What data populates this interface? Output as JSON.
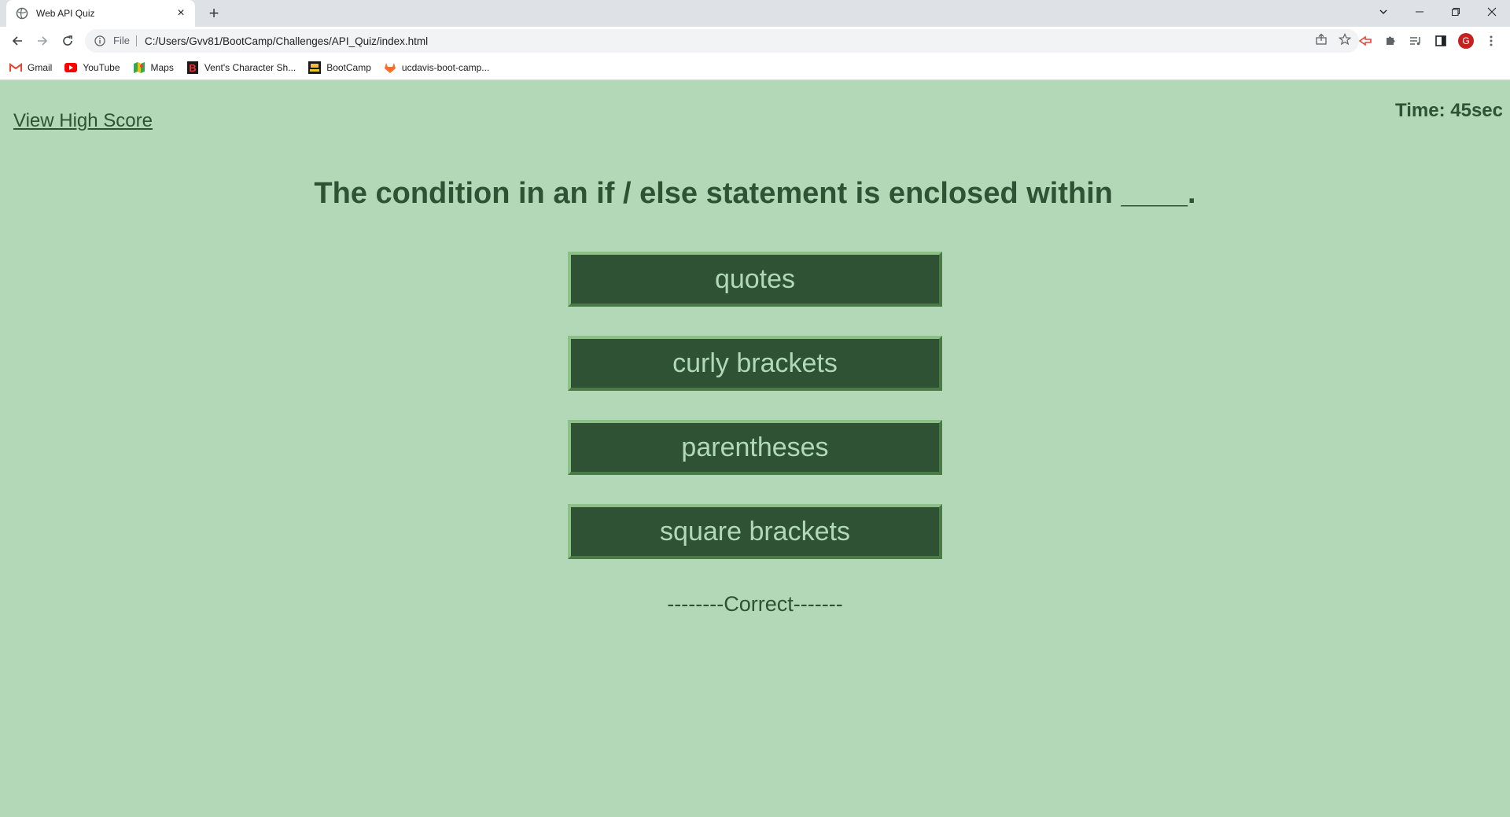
{
  "browser": {
    "tab_title": "Web API Quiz",
    "new_tab_symbol": "+",
    "close_symbol": "×",
    "protocol_label": "File",
    "url": "C:/Users/Gvv81/BootCamp/Challenges/API_Quiz/index.html",
    "profile_initial": "G",
    "bookmarks": [
      {
        "label": "Gmail",
        "icon": "gmail-icon"
      },
      {
        "label": "YouTube",
        "icon": "youtube-icon"
      },
      {
        "label": "Maps",
        "icon": "maps-icon"
      },
      {
        "label": "Vent's Character Sh...",
        "icon": "b-icon"
      },
      {
        "label": "BootCamp",
        "icon": "ucb-icon"
      },
      {
        "label": "ucdavis-boot-camp...",
        "icon": "gitlab-icon"
      }
    ]
  },
  "quiz": {
    "highscore_link": "View High Score",
    "timer": "Time: 45sec",
    "question": "The condition in an if / else statement is enclosed within ____.",
    "choices": [
      "quotes",
      "curly brackets",
      "parentheses",
      "square brackets"
    ],
    "result": "--------Correct-------"
  },
  "colors": {
    "background": "#b2d8b7",
    "text": "#2e5233",
    "button_bg": "#2e5233",
    "button_text": "#b2d8b7"
  }
}
